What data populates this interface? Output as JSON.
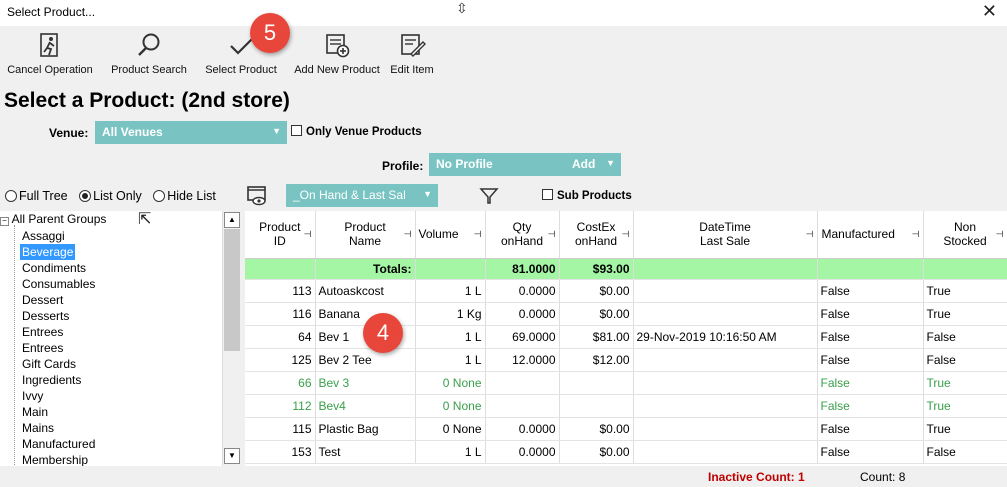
{
  "window": {
    "title": "Select Product...",
    "close": "✕"
  },
  "toolbar": {
    "cancel": "Cancel Operation",
    "search": "Product Search",
    "select": "Select Product",
    "add": "Add New Product",
    "edit": "Edit Item"
  },
  "badges": {
    "five": "5",
    "four": "4"
  },
  "page_title": "Select a Product: (2nd store)",
  "venue": {
    "label": "Venue:",
    "value": "All Venues",
    "only_venue": "Only Venue Products"
  },
  "profile": {
    "label": "Profile:",
    "value": "No Profile",
    "add": "Add"
  },
  "view": {
    "full_tree": "Full Tree",
    "list_only": "List Only",
    "hide_list": "Hide List",
    "selected": "List Only",
    "filter_value": "_On Hand & Last Sal",
    "sub_products": "Sub Products"
  },
  "tree": {
    "root": "All Parent Groups",
    "items": [
      "Assaggi",
      "Beverage",
      "Condiments",
      "Consumables",
      "Dessert",
      "Desserts",
      "Entrees",
      "Entrees",
      "Gift Cards",
      "Ingredients",
      "Ivvy",
      "Main",
      "Mains",
      "Manufactured",
      "Membership"
    ],
    "selected": "Beverage"
  },
  "grid": {
    "headers": {
      "product_id": [
        "Product",
        "ID"
      ],
      "product_name": [
        "Product",
        "Name"
      ],
      "volume": "Volume",
      "qty": [
        "Qty",
        "onHand"
      ],
      "cost": [
        "CostEx",
        "onHand"
      ],
      "datetime": [
        "DateTime",
        "Last Sale"
      ],
      "manufactured": "Manufactured",
      "non_stocked": [
        "Non",
        "Stocked"
      ]
    },
    "totals": {
      "label": "Totals:",
      "qty": "81.0000",
      "cost": "$93.00"
    },
    "rows": [
      {
        "id": "113",
        "name": "Autoaskcost",
        "volume": "1 L",
        "qty": "0.0000",
        "cost": "$0.00",
        "date": "",
        "manufactured": "False",
        "non_stocked": "True",
        "inactive": false
      },
      {
        "id": "116",
        "name": "Banana",
        "volume": "1 Kg",
        "qty": "0.0000",
        "cost": "$0.00",
        "date": "",
        "manufactured": "False",
        "non_stocked": "True",
        "inactive": false
      },
      {
        "id": "64",
        "name": "Bev 1",
        "volume": "1 L",
        "qty": "69.0000",
        "cost": "$81.00",
        "date": "29-Nov-2019 10:16:50 AM",
        "manufactured": "False",
        "non_stocked": "False",
        "inactive": false
      },
      {
        "id": "125",
        "name": "Bev 2 Tee",
        "volume": "1 L",
        "qty": "12.0000",
        "cost": "$12.00",
        "date": "",
        "manufactured": "False",
        "non_stocked": "False",
        "inactive": false
      },
      {
        "id": "66",
        "name": "Bev 3",
        "volume": "0 None",
        "qty": "",
        "cost": "",
        "date": "",
        "manufactured": "False",
        "non_stocked": "True",
        "inactive": true
      },
      {
        "id": "112",
        "name": "Bev4",
        "volume": "0 None",
        "qty": "",
        "cost": "",
        "date": "",
        "manufactured": "False",
        "non_stocked": "True",
        "inactive": true
      },
      {
        "id": "115",
        "name": "Plastic Bag",
        "volume": "0 None",
        "qty": "0.0000",
        "cost": "$0.00",
        "date": "",
        "manufactured": "False",
        "non_stocked": "True",
        "inactive": false
      },
      {
        "id": "153",
        "name": "Test",
        "volume": "1 L",
        "qty": "0.0000",
        "cost": "$0.00",
        "date": "",
        "manufactured": "False",
        "non_stocked": "False",
        "inactive": false
      }
    ]
  },
  "status": {
    "inactive": "Inactive Count: 1",
    "count": "Count: 8"
  },
  "colors": {
    "teal": "#79c4c2",
    "totals_green": "#a4f5a4",
    "inactive_text": "#3aa04b",
    "badge_red": "#e8463a",
    "selection_blue": "#3399ff"
  }
}
